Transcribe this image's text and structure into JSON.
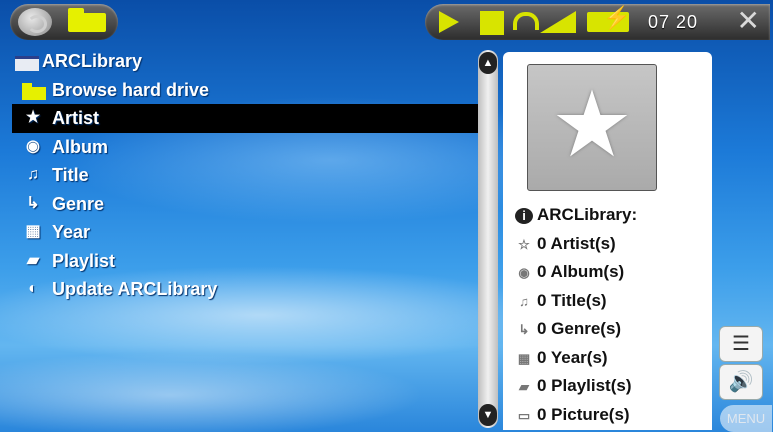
{
  "status_bar": {
    "time": "07 20",
    "icons": [
      "sync-icon",
      "folder-icon",
      "arrow-icon",
      "square-icon",
      "headphones-icon",
      "signal-icon",
      "battery-charging-icon",
      "close-icon"
    ]
  },
  "list": {
    "items": [
      {
        "icon": "hdd-icon",
        "label": "ARCLibrary"
      },
      {
        "icon": "folder-icon",
        "label": "Browse hard drive"
      },
      {
        "icon": "star-icon",
        "label": "Artist"
      },
      {
        "icon": "disc-icon",
        "label": "Album"
      },
      {
        "icon": "music-note-icon",
        "label": "Title"
      },
      {
        "icon": "genre-icon",
        "label": "Genre"
      },
      {
        "icon": "calendar-icon",
        "label": "Year"
      },
      {
        "icon": "playlist-icon",
        "label": "Playlist"
      },
      {
        "icon": "refresh-icon",
        "label": "Update ARCLibrary"
      }
    ],
    "selected": "Artist"
  },
  "info": {
    "title": "ARCLibrary:",
    "rows": [
      {
        "icon": "star-icon",
        "label": "0 Artist(s)"
      },
      {
        "icon": "disc-icon",
        "label": "0 Album(s)"
      },
      {
        "icon": "music-note-icon",
        "label": "0 Title(s)"
      },
      {
        "icon": "genre-icon",
        "label": "0 Genre(s)"
      },
      {
        "icon": "calendar-icon",
        "label": "0 Year(s)"
      },
      {
        "icon": "playlist-icon",
        "label": "0 Playlist(s)"
      },
      {
        "icon": "picture-icon",
        "label": "0 Picture(s)"
      }
    ]
  },
  "buttons": {
    "menu": "MENU"
  },
  "colors": {
    "accent_yellow": "#d8e400",
    "selection": "#000000"
  }
}
